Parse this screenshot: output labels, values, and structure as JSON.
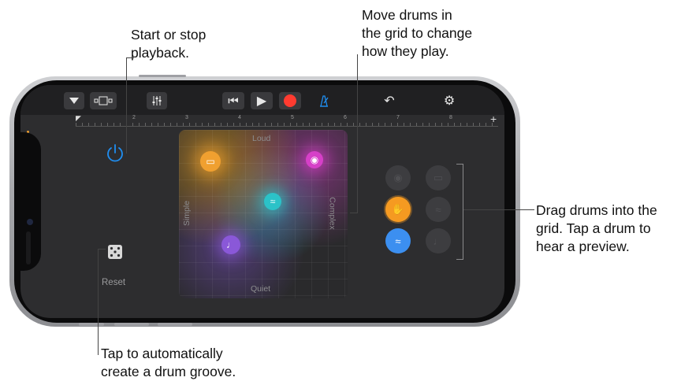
{
  "callouts": {
    "playback": "Start or stop\nplayback.",
    "move": "Move drums in\nthe grid to change\nhow they play.",
    "drag": "Drag drums into the\ngrid. Tap a drum to\nhear a preview.",
    "auto": "Tap to automatically\ncreate a drum groove."
  },
  "toolbar": {
    "browser_icon": "triangle-down-icon",
    "view_icon": "track-view-icon",
    "mixer_icon": "mixer-icon",
    "rewind_glyph": "⏮",
    "play_glyph": "▶",
    "metronome_glyph": "♪",
    "undo_glyph": "↶",
    "settings_glyph": "⚙"
  },
  "ruler": {
    "marks": [
      "2",
      "3",
      "4",
      "5",
      "6",
      "7",
      "8"
    ],
    "add": "+"
  },
  "controls": {
    "power_glyph": "⏻",
    "dice_glyph": "⚄",
    "reset_label": "Reset"
  },
  "pad": {
    "top": "Loud",
    "bottom": "Quiet",
    "left": "Simple",
    "right": "Complex"
  },
  "drums": {
    "kick": "▭",
    "cymbal": "◉",
    "snare": "≈",
    "shaker": "♩",
    "hands": "✋",
    "bass": "≈"
  },
  "colors": {
    "accent_blue": "#1f8ef1",
    "record_red": "#ff3b30",
    "kick_orange": "#f0a030",
    "cymbal_pink": "#d640c8",
    "snare_teal": "#2bc2c8",
    "shaker_purple": "#8a58d8",
    "hands_orange": "#f59a21",
    "bass_blue": "#3c8ff0"
  }
}
